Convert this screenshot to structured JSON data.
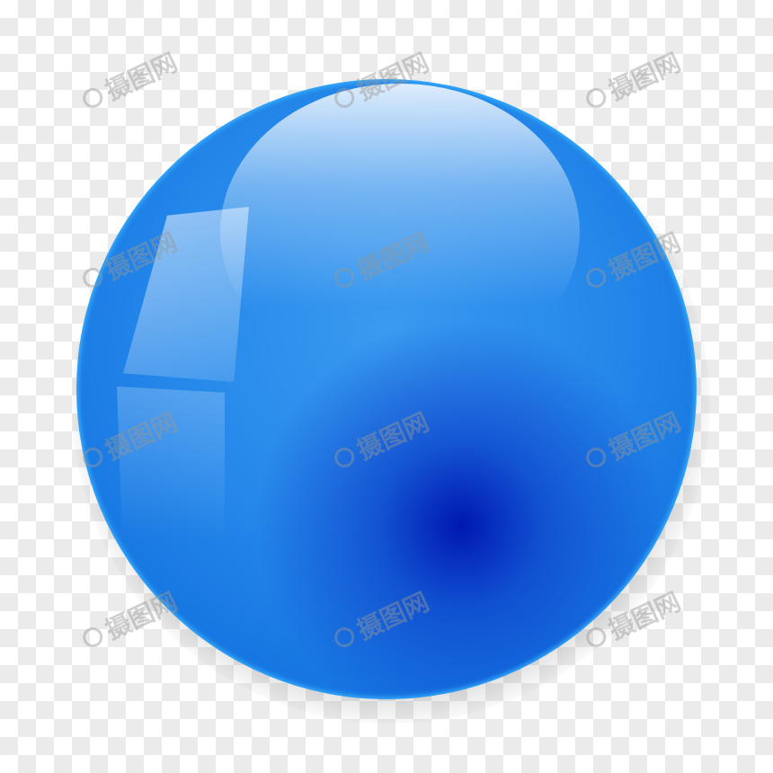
{
  "image": {
    "subject": "glossy-blue-sphere",
    "colors": {
      "sphere": "#2588ea",
      "core": "#0018b0",
      "rim": "#39b4ff",
      "checker_light": "#ffffff",
      "checker_dark": "#ebebeb"
    }
  },
  "watermark": {
    "text": "摄图网"
  }
}
